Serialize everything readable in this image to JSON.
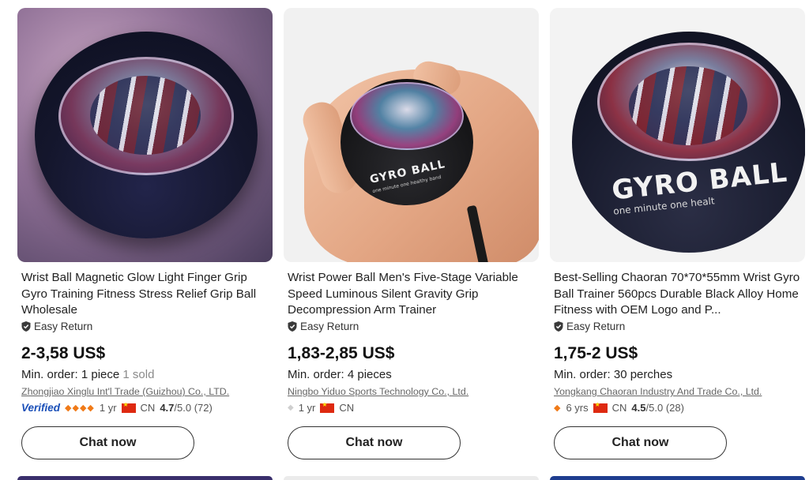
{
  "products": [
    {
      "image_alt": "Wrist ball gyro product photo",
      "title": "Wrist Ball Magnetic Glow Light Finger Grip Gyro Training Fitness Stress Relief Grip Ball Wholesale",
      "easy_return": "Easy Return",
      "price": "2-3,58 US$",
      "min_order": "Min. order: 1 piece",
      "sold": "1 sold",
      "supplier": "Zhongjiao Xinglu Int'l Trade (Guizhou) Co., LTD.",
      "verified": "Verified",
      "diamonds": "◆◆◆◆",
      "years": "1 yr",
      "country": "CN",
      "rating": "4.7",
      "rating_max": "/5.0",
      "reviews": "(72)",
      "chat": "Chat now"
    },
    {
      "image_alt": "Hand holding gyro ball",
      "img_label": "GYRO BALL",
      "img_sublabel": "one minute one healthy band",
      "title": "Wrist Power Ball Men's Five-Stage Variable Speed Luminous Silent Gravity Grip Decompression Arm Trainer",
      "easy_return": "Easy Return",
      "price": "1,83-2,85 US$",
      "min_order": "Min. order: 4 pieces",
      "supplier": "Ningbo Yiduo Sports Technology Co., Ltd.",
      "diamonds": "◆",
      "years": "1 yr",
      "country": "CN",
      "chat": "Chat now"
    },
    {
      "image_alt": "Gyro ball close-up",
      "img_label": "GYRO BALL",
      "img_sublabel": "one minute one healt",
      "title": "Best-Selling Chaoran 70*70*55mm Wrist Gyro Ball Trainer 560pcs Durable Black Alloy Home Fitness with OEM Logo and P...",
      "easy_return": "Easy Return",
      "price": "1,75-2 US$",
      "min_order": "Min. order: 30 perches",
      "supplier": "Yongkang Chaoran Industry And Trade Co., Ltd.",
      "diamonds": "◆",
      "years": "6 yrs",
      "country": "CN",
      "rating": "4.5",
      "rating_max": "/5.0",
      "reviews": "(28)",
      "chat": "Chat now"
    }
  ],
  "colors": {
    "verified": "#1a4fb8",
    "diamond": "#f07a18",
    "flag": "#de2910"
  }
}
